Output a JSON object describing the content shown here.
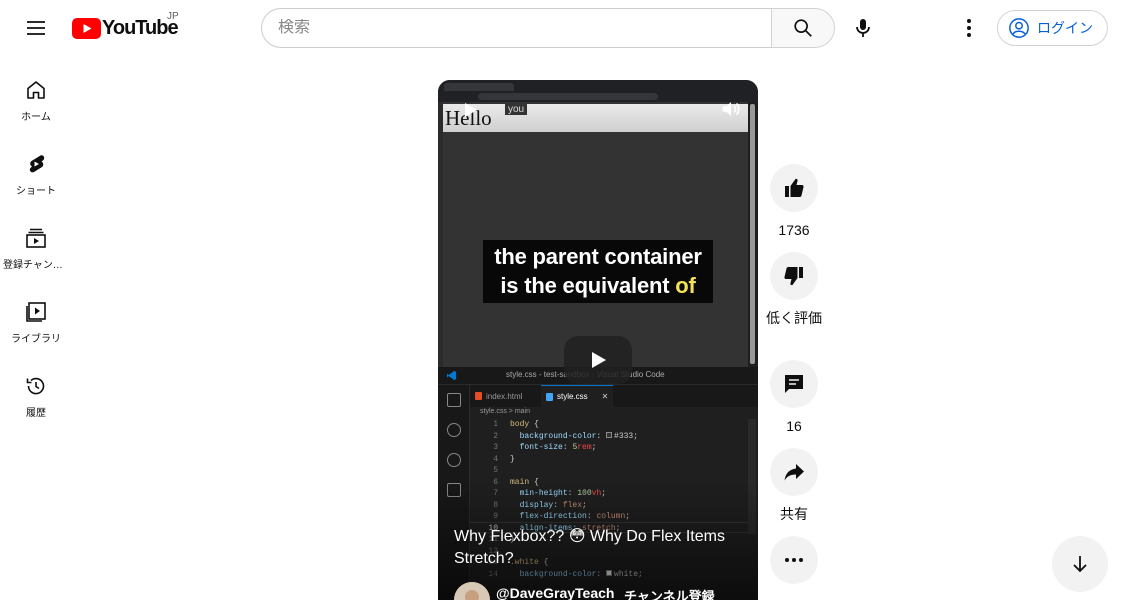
{
  "header": {
    "logo_text": "YouTube",
    "country_code": "JP",
    "search_placeholder": "検索",
    "login_label": "ログイン"
  },
  "sidebar": {
    "items": [
      {
        "label": "ホーム",
        "icon": "home-icon"
      },
      {
        "label": "ショート",
        "icon": "shorts-icon"
      },
      {
        "label": "登録チャンネル",
        "icon": "subscriptions-icon"
      },
      {
        "label": "ライブラリ",
        "icon": "library-icon"
      },
      {
        "label": "履歴",
        "icon": "history-icon"
      }
    ]
  },
  "player": {
    "page_text": "Hello",
    "tooltip_text": "you",
    "caption_main": "the parent container is the equivalent ",
    "caption_highlight": "of",
    "title": "Why Flexbox?? 😳 Why Do Flex Items Stretch?",
    "channel_handle": "@DaveGrayTeach",
    "subscribe_label": "チャンネル登録",
    "editor": {
      "window_title": "style.css - test-sandbox - Visual Studio Code",
      "tab_html": "index.html",
      "tab_css": "style.css",
      "breadcrumb_file": "style.css",
      "breadcrumb_symbol": "main",
      "current_line": "10"
    }
  },
  "actions": {
    "like_count": "1736",
    "dislike_label": "低く評価",
    "comment_count": "16",
    "share_label": "共有"
  },
  "colors": {
    "brand_red": "#ff0000",
    "link_blue": "#065fd4",
    "caption_highlight": "#f4e05a"
  }
}
